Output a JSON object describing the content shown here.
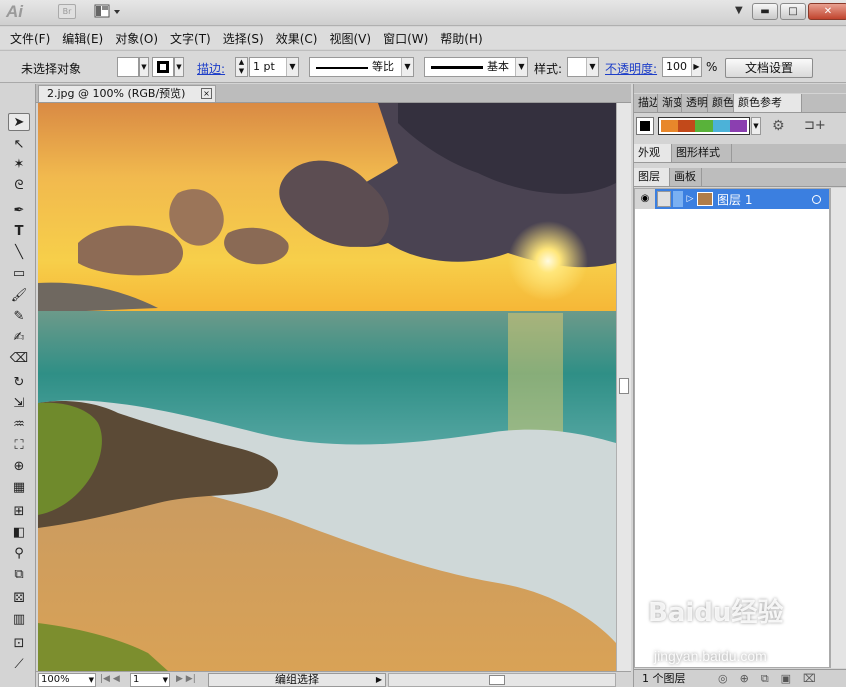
{
  "app": {
    "logo": "Ai",
    "bridge": "Br",
    "workspace_arrow": "▼"
  },
  "menu": [
    "文件(F)",
    "编辑(E)",
    "对象(O)",
    "文字(T)",
    "选择(S)",
    "效果(C)",
    "视图(V)",
    "窗口(W)",
    "帮助(H)"
  ],
  "control_bar": {
    "selection_status": "未选择对象",
    "stroke_label": "描边:",
    "stroke_weight": "1 pt",
    "profile_label": "等比",
    "brush_label": "基本",
    "style_label": "样式:",
    "opacity_label": "不透明度:",
    "opacity_value": "100",
    "opacity_unit": "%",
    "doc_setup_button": "文档设置"
  },
  "document_tab": {
    "title": "2.jpg @ 100% (RGB/预览)",
    "close": "×"
  },
  "status_bar": {
    "zoom": "100%",
    "artboard": "1",
    "status": "编组选择"
  },
  "right_panel": {
    "top_tabs": [
      "描边",
      "渐变",
      "透明",
      "颜色",
      "颜色参考"
    ],
    "color_guide_colors": [
      "#e8872b",
      "#c2491a",
      "#59b23a",
      "#4cb2d8",
      "#8b3fb0"
    ],
    "mid_tabs": [
      "外观",
      "图形样式"
    ],
    "layer_tabs": [
      "图层",
      "画板"
    ],
    "layer_name": "图层 1",
    "layer_count": "1 个图层"
  },
  "watermark": {
    "brand": "Baidu经验",
    "url": "jingyan.baidu.com"
  },
  "colors": {
    "accent": "#3b7fe0"
  }
}
